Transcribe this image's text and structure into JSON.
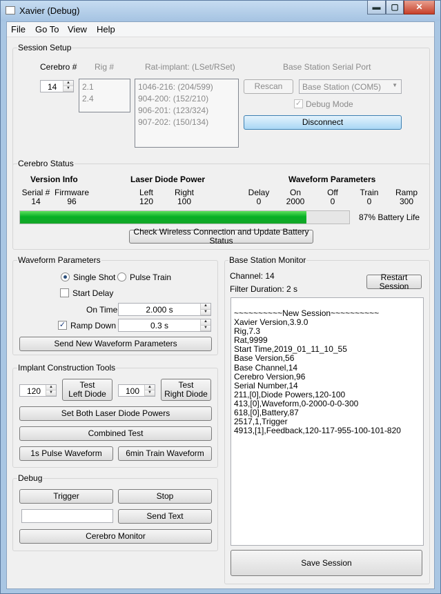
{
  "window": {
    "title": "Xavier (Debug)",
    "minimize": "▬",
    "maximize": "▢",
    "close": "✕"
  },
  "menu": [
    "File",
    "Go To",
    "View",
    "Help"
  ],
  "session_setup": {
    "title": "Session Setup",
    "cerebro_label": "Cerebro #",
    "cerebro_value": "14",
    "rig_label": "Rig #",
    "rig_items": [
      "2.1",
      "2.4"
    ],
    "rat_label": "Rat-implant: (LSet/RSet)",
    "rat_items": [
      "1046-216: (204/599)",
      "904-200: (152/210)",
      "906-201: (123/324)",
      "907-202: (150/134)"
    ],
    "serial_label": "Base Station Serial Port",
    "rescan": "Rescan",
    "port_value": "Base Station (COM5)",
    "debug_mode": "Debug Mode",
    "disconnect": "Disconnect"
  },
  "cerebro_status": {
    "title": "Cerebro Status",
    "version_info": "Version Info",
    "laser_power": "Laser Diode Power",
    "waveform_params": "Waveform Parameters",
    "serial_h": "Serial #",
    "serial_v": "14",
    "firmware_h": "Firmware",
    "firmware_v": "96",
    "left_h": "Left",
    "left_v": "120",
    "right_h": "Right",
    "right_v": "100",
    "delay_h": "Delay",
    "delay_v": "0",
    "on_h": "On",
    "on_v": "2000",
    "off_h": "Off",
    "off_v": "0",
    "train_h": "Train",
    "train_v": "0",
    "ramp_h": "Ramp",
    "ramp_v": "300",
    "battery_fraction": 0.87,
    "battery_text": "87% Battery Life",
    "check_button": "Check Wireless Connection and Update Battery Status"
  },
  "waveform": {
    "title": "Waveform Parameters",
    "single_shot": "Single Shot",
    "pulse_train": "Pulse Train",
    "start_delay": "Start Delay",
    "on_time_label": "On Time",
    "on_time_value": "2.000 s",
    "ramp_down": "Ramp Down",
    "ramp_value": "0.3 s",
    "send_button": "Send New Waveform Parameters"
  },
  "implant": {
    "title": "Implant Construction Tools",
    "left_value": "120",
    "test_left": [
      "Test",
      "Left Diode"
    ],
    "right_value": "100",
    "test_right": [
      "Test",
      "Right Diode"
    ],
    "set_both": "Set Both Laser Diode Powers",
    "combined": "Combined Test",
    "pulse_1s": "1s Pulse Waveform",
    "train_6min": "6min Train Waveform"
  },
  "debug": {
    "title": "Debug",
    "trigger": "Trigger",
    "stop": "Stop",
    "text_value": "",
    "send_text": "Send Text",
    "cerebro_monitor": "Cerebro Monitor"
  },
  "base_station": {
    "title": "Base Station Monitor",
    "channel": "Channel: 14",
    "filter": "Filter Duration: 2 s",
    "restart": "Restart Session",
    "log": [
      "~~~~~~~~~~New Session~~~~~~~~~~",
      "Xavier Version,3.9.0",
      "Rig,7.3",
      "Rat,9999",
      "Start Time,2019_01_11_10_55",
      "Base Version,56",
      "Base Channel,14",
      "Cerebro Version,96",
      "Serial Number,14",
      "211,[0],Diode Powers,120-100",
      "413,[0],Waveform,0-2000-0-0-300",
      "618,[0],Battery,87",
      "2517,1,Trigger",
      "4913,[1],Feedback,120-117-955-100-101-820"
    ],
    "save": "Save Session"
  }
}
